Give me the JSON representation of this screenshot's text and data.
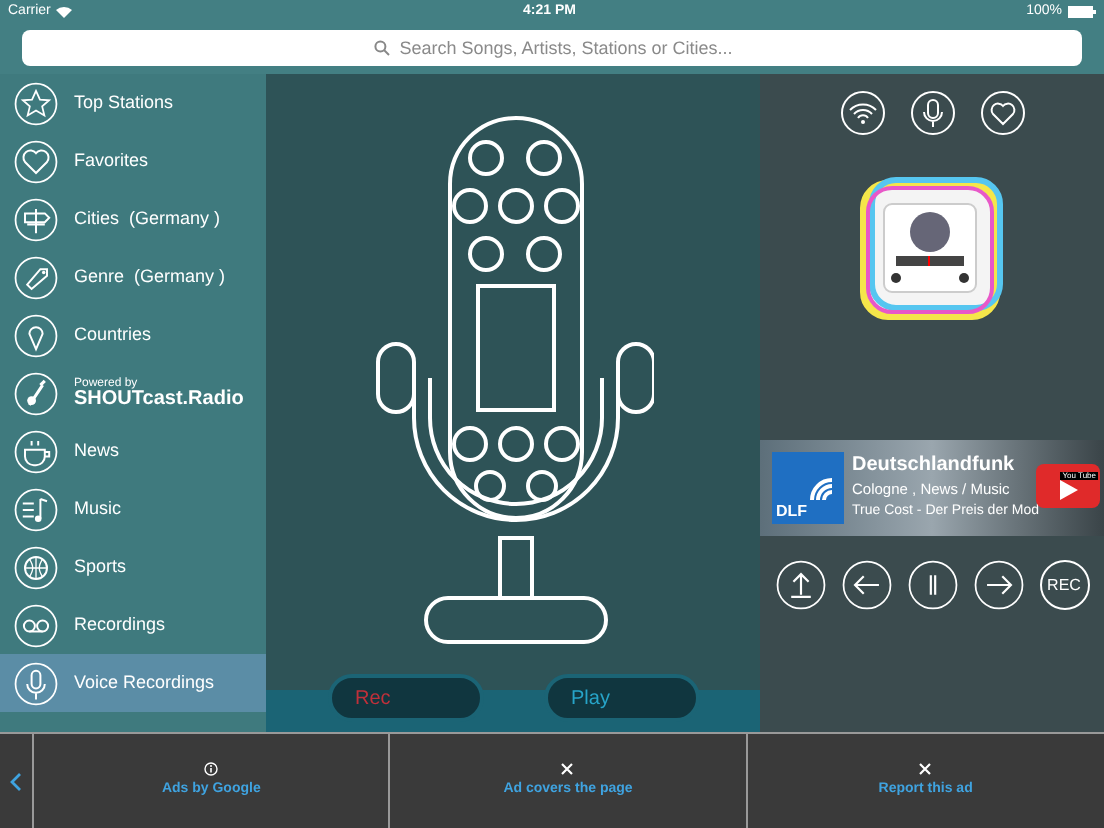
{
  "status_bar": {
    "carrier": "Carrier",
    "time": "4:21 PM",
    "battery": "100%"
  },
  "search": {
    "placeholder": "Search Songs, Artists, Stations or Cities..."
  },
  "sidebar": {
    "items": [
      {
        "kind": "item",
        "label": "Top Stations",
        "selected": false
      },
      {
        "kind": "item",
        "label": "Favorites",
        "selected": false
      },
      {
        "kind": "item",
        "label": "Cities  (Germany )",
        "selected": false
      },
      {
        "kind": "item",
        "label": "Genre  (Germany )",
        "selected": false
      },
      {
        "kind": "item",
        "label": "Countries",
        "selected": false
      },
      {
        "kind": "logo",
        "label": "SHOUTcast.Radio",
        "caption": "Powered by",
        "selected": false
      },
      {
        "kind": "item",
        "label": "News",
        "selected": false
      },
      {
        "kind": "item",
        "label": "Music",
        "selected": false
      },
      {
        "kind": "item",
        "label": "Sports",
        "selected": false
      },
      {
        "kind": "item",
        "label": "Recordings",
        "selected": false
      },
      {
        "kind": "item",
        "label": "Voice Recordings",
        "selected": true
      }
    ]
  },
  "recorder": {
    "buttons": [
      {
        "kind": "rec",
        "label": "Rec"
      },
      {
        "kind": "play",
        "label": "Play"
      }
    ]
  },
  "now_playing": {
    "station": "Deutschlandfunk",
    "details": "Cologne , News / Music",
    "logo_text": "DLF",
    "track": "True Cost - Der Preis der Mod",
    "video_badge": "You Tube"
  },
  "controls": [
    {
      "kind": "upload"
    },
    {
      "kind": "back"
    },
    {
      "kind": "pause"
    },
    {
      "kind": "forward"
    },
    {
      "kind": "rec",
      "label": "REC"
    }
  ],
  "ad_bar": {
    "items": [
      {
        "kind": "info",
        "label": "Ads by Google"
      },
      {
        "kind": "close",
        "label": "Ad covers the page"
      },
      {
        "kind": "close",
        "label": "Report this ad"
      }
    ]
  }
}
